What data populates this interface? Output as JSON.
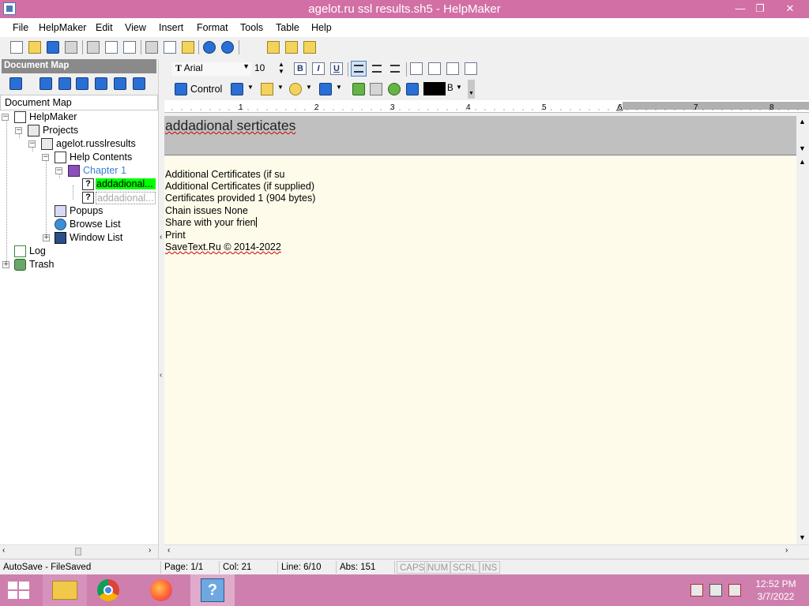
{
  "window": {
    "title": "agelot.ru ssl results.sh5 - HelpMaker",
    "minimize": "—",
    "restore": "❐",
    "close": "✕"
  },
  "menu": [
    "File",
    "HelpMaker",
    "Edit",
    "View",
    "Insert",
    "Format",
    "Tools",
    "Table",
    "Help"
  ],
  "docmap": {
    "header": "Document Map",
    "label": "Document Map",
    "tree": [
      {
        "label": "HelpMaker",
        "icon": "home-icon"
      },
      {
        "label": "Projects",
        "icon": "projects-icon"
      },
      {
        "label": "agelot.russlresults",
        "icon": "project-icon"
      },
      {
        "label": "Help Contents",
        "icon": "contents-icon"
      },
      {
        "label": "Chapter 1",
        "icon": "book-icon"
      },
      {
        "label": "addadional...",
        "icon": "topic-icon",
        "state": "selected"
      },
      {
        "label": "addadional...",
        "icon": "topic-icon",
        "state": "dim"
      },
      {
        "label": "Popups",
        "icon": "popups-icon"
      },
      {
        "label": "Browse List",
        "icon": "globe-icon"
      },
      {
        "label": "Window List",
        "icon": "window-list-icon"
      },
      {
        "label": "Log",
        "icon": "log-icon"
      },
      {
        "label": "Trash",
        "icon": "trash-icon"
      }
    ]
  },
  "format_toolbar": {
    "font": "Arial",
    "size": "10",
    "bold": "B",
    "italic": "I",
    "underline": "U"
  },
  "insert_toolbar": {
    "control_label": "Control",
    "color_label": "B"
  },
  "ruler": [
    "1",
    "2",
    "3",
    "4",
    "5",
    "6",
    "7",
    "8"
  ],
  "editor": {
    "topic_title": "addadional serticates",
    "lines": [
      "Additional Certificates (if su",
      "Additional Certificates (if supplied)",
      "Certificates provided   1 (904 bytes)",
      "Chain issues   None",
      "Share with your frien",
      "Print",
      "SaveText.Ru © 2014-2022"
    ]
  },
  "statusbar": {
    "autosave": "AutoSave - FileSaved",
    "page": "Page: 1/1",
    "col": "Col: 21",
    "line": "Line: 6/10",
    "abs": "Abs: 151",
    "caps": "CAPS",
    "num": "NUM",
    "scrl": "SCRL",
    "ins": "INS"
  },
  "taskbar": {
    "time": "12:52 PM",
    "date": "3/7/2022"
  },
  "colors": {
    "titlebar": "#d26fa5",
    "taskbar": "#cf7fae",
    "selected_node_bg": "#00ff00",
    "editor_bg": "#fefbea",
    "topic_title_bg": "#c0c0c0"
  }
}
